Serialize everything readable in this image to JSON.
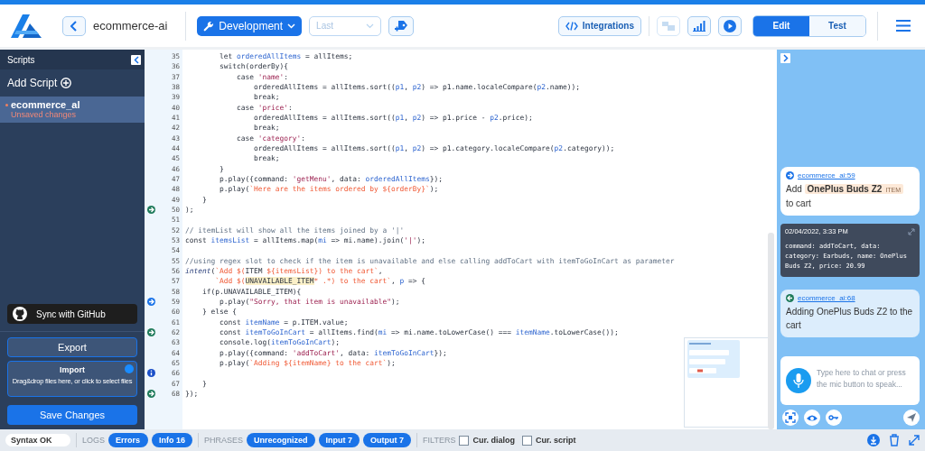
{
  "header": {
    "project": "ecommerce-ai",
    "environment": "Development",
    "version_placeholder": "Last",
    "integrations": "Integrations",
    "modes": [
      {
        "label": "Edit",
        "selected": true
      },
      {
        "label": "Test",
        "selected": false
      }
    ]
  },
  "sidebar": {
    "title": "Scripts",
    "add_script": "Add Script",
    "scripts": [
      {
        "name": "ecommerce_al",
        "status": "Unsaved changes",
        "selected": true
      }
    ],
    "github": "Sync with GitHub",
    "export": "Export",
    "import_title": "Import",
    "import_hint": "Drag&drop files here, or click to select files",
    "save": "Save Changes"
  },
  "editor": {
    "lines": [
      {
        "number": "35",
        "segments": [
          {
            "kind": "plain",
            "text": "        let "
          },
          {
            "kind": "var",
            "text": "orderedAllItems"
          },
          {
            "kind": "plain",
            "text": " = allItems;"
          }
        ]
      },
      {
        "number": "36",
        "segments": [
          {
            "kind": "plain",
            "text": "        switch(orderBy){"
          }
        ]
      },
      {
        "number": "37",
        "segments": [
          {
            "kind": "plain",
            "text": "            case "
          },
          {
            "kind": "string",
            "text": "'name'"
          },
          {
            "kind": "plain",
            "text": ":"
          }
        ]
      },
      {
        "number": "38",
        "segments": [
          {
            "kind": "plain",
            "text": "                orderedAllItems = allItems.sort(("
          },
          {
            "kind": "var",
            "text": "p1"
          },
          {
            "kind": "plain",
            "text": ", "
          },
          {
            "kind": "var",
            "text": "p2"
          },
          {
            "kind": "plain",
            "text": ") => p1.name.localeCompare("
          },
          {
            "kind": "var",
            "text": "p2"
          },
          {
            "kind": "plain",
            "text": ".name));"
          }
        ]
      },
      {
        "number": "39",
        "segments": [
          {
            "kind": "plain",
            "text": "                break;"
          }
        ]
      },
      {
        "number": "40",
        "segments": [
          {
            "kind": "plain",
            "text": "            case "
          },
          {
            "kind": "string",
            "text": "'price'"
          },
          {
            "kind": "plain",
            "text": ":"
          }
        ]
      },
      {
        "number": "41",
        "segments": [
          {
            "kind": "plain",
            "text": "                orderedAllItems = allItems.sort(("
          },
          {
            "kind": "var",
            "text": "p1"
          },
          {
            "kind": "plain",
            "text": ", "
          },
          {
            "kind": "var",
            "text": "p2"
          },
          {
            "kind": "plain",
            "text": ") => p1.price - "
          },
          {
            "kind": "var",
            "text": "p2"
          },
          {
            "kind": "plain",
            "text": ".price);"
          }
        ]
      },
      {
        "number": "42",
        "segments": [
          {
            "kind": "plain",
            "text": "                break;"
          }
        ]
      },
      {
        "number": "43",
        "segments": [
          {
            "kind": "plain",
            "text": "            case "
          },
          {
            "kind": "string",
            "text": "'category'"
          },
          {
            "kind": "plain",
            "text": ":"
          }
        ]
      },
      {
        "number": "44",
        "segments": [
          {
            "kind": "plain",
            "text": "                orderedAllItems = allItems.sort(("
          },
          {
            "kind": "var",
            "text": "p1"
          },
          {
            "kind": "plain",
            "text": ", "
          },
          {
            "kind": "var",
            "text": "p2"
          },
          {
            "kind": "plain",
            "text": ") => p1.category.localeCompare("
          },
          {
            "kind": "var",
            "text": "p2"
          },
          {
            "kind": "plain",
            "text": ".category));"
          }
        ]
      },
      {
        "number": "45",
        "segments": [
          {
            "kind": "plain",
            "text": "                break;"
          }
        ]
      },
      {
        "number": "46",
        "segments": [
          {
            "kind": "plain",
            "text": "        }"
          }
        ]
      },
      {
        "number": "47",
        "segments": [
          {
            "kind": "plain",
            "text": "        p.play({command: "
          },
          {
            "kind": "string",
            "text": "'getMenu'"
          },
          {
            "kind": "plain",
            "text": ", data: "
          },
          {
            "kind": "var",
            "text": "orderedAllItems"
          },
          {
            "kind": "plain",
            "text": "});"
          }
        ]
      },
      {
        "number": "48",
        "segments": [
          {
            "kind": "plain",
            "text": "        p.play("
          },
          {
            "kind": "template",
            "text": "`Here are the items ordered by ${orderBy}`"
          },
          {
            "kind": "plain",
            "text": ");"
          }
        ]
      },
      {
        "number": "49",
        "segments": [
          {
            "kind": "plain",
            "text": "    }"
          }
        ]
      },
      {
        "number": "50",
        "marker": {
          "kind": "out"
        },
        "segments": [
          {
            "kind": "plain",
            "text": ");"
          }
        ]
      },
      {
        "number": "51"
      },
      {
        "number": "52",
        "segments": [
          {
            "kind": "comment",
            "text": "// itemList will show all the items joined by a '|'"
          }
        ]
      },
      {
        "number": "53",
        "segments": [
          {
            "kind": "plain",
            "text": "const "
          },
          {
            "kind": "var",
            "text": "itemsList"
          },
          {
            "kind": "plain",
            "text": " = allItems.map("
          },
          {
            "kind": "var",
            "text": "mi"
          },
          {
            "kind": "plain",
            "text": " => mi.name).join("
          },
          {
            "kind": "string",
            "text": "'|'"
          },
          {
            "kind": "plain",
            "text": ");"
          }
        ]
      },
      {
        "number": "54"
      },
      {
        "number": "55",
        "segments": [
          {
            "kind": "comment",
            "text": "//using regex slot to check if the item is unavailable and else calling addToCart with itemToGoInCart as parameter"
          }
        ]
      },
      {
        "number": "56",
        "segments": [
          {
            "kind": "function",
            "text": "intent"
          },
          {
            "kind": "plain",
            "text": "("
          },
          {
            "kind": "template",
            "text": "`Add $("
          },
          {
            "kind": "plain",
            "text": "ITEM "
          },
          {
            "kind": "template",
            "text": "${itemsList}) to the cart`"
          },
          {
            "kind": "plain",
            "text": ","
          }
        ]
      },
      {
        "number": "57",
        "segments": [
          {
            "kind": "template",
            "text": "       `Add $("
          },
          {
            "kind": "match",
            "text": "UNAVAILABLE_ITEM"
          },
          {
            "kind": "template",
            "text": "* .*) to the cart`"
          },
          {
            "kind": "plain",
            "text": ", "
          },
          {
            "kind": "var",
            "text": "p"
          },
          {
            "kind": "plain",
            "text": " => {"
          }
        ]
      },
      {
        "number": "58",
        "segments": [
          {
            "kind": "plain",
            "text": "    if(p.UNAVAILABLE_ITEM){"
          }
        ]
      },
      {
        "number": "59",
        "marker": {
          "kind": "in"
        },
        "segments": [
          {
            "kind": "plain",
            "text": "        p.play("
          },
          {
            "kind": "string",
            "text": "\"Sorry, that item is unavailable\""
          },
          {
            "kind": "plain",
            "text": ");"
          }
        ]
      },
      {
        "number": "60",
        "segments": [
          {
            "kind": "plain",
            "text": "    } else {"
          }
        ]
      },
      {
        "number": "61",
        "segments": [
          {
            "kind": "plain",
            "text": "        const "
          },
          {
            "kind": "var",
            "text": "itemName"
          },
          {
            "kind": "plain",
            "text": " = p.ITEM.value;"
          }
        ]
      },
      {
        "number": "62",
        "marker": {
          "kind": "out"
        },
        "segments": [
          {
            "kind": "plain",
            "text": "        const "
          },
          {
            "kind": "var",
            "text": "itemToGoInCart"
          },
          {
            "kind": "plain",
            "text": " = allItems.find("
          },
          {
            "kind": "var",
            "text": "mi"
          },
          {
            "kind": "plain",
            "text": " => mi.name.toLowerCase() === "
          },
          {
            "kind": "var",
            "text": "itemName"
          },
          {
            "kind": "plain",
            "text": ".toLowerCase());"
          }
        ]
      },
      {
        "number": "63",
        "segments": [
          {
            "kind": "plain",
            "text": "        console.log("
          },
          {
            "kind": "var",
            "text": "itemToGoInCart"
          },
          {
            "kind": "plain",
            "text": ");"
          }
        ]
      },
      {
        "number": "64",
        "segments": [
          {
            "kind": "plain",
            "text": "        p.play({command: "
          },
          {
            "kind": "string",
            "text": "'addToCart'"
          },
          {
            "kind": "plain",
            "text": ", data: "
          },
          {
            "kind": "var",
            "text": "itemToGoInCart"
          },
          {
            "kind": "plain",
            "text": "});"
          }
        ]
      },
      {
        "number": "65",
        "segments": [
          {
            "kind": "plain",
            "text": "        p.play("
          },
          {
            "kind": "template",
            "text": "`Adding ${itemName} to the cart`"
          },
          {
            "kind": "plain",
            "text": ");"
          }
        ]
      },
      {
        "number": "66",
        "marker": {
          "kind": "info"
        }
      },
      {
        "number": "67",
        "segments": [
          {
            "kind": "plain",
            "text": "    }"
          }
        ]
      },
      {
        "number": "68",
        "marker": {
          "kind": "out"
        },
        "segments": [
          {
            "kind": "plain",
            "text": "});"
          }
        ]
      }
    ]
  },
  "chat": {
    "messages": [
      {
        "kind": "input",
        "source": "ecommerce_ai:59",
        "parts": [
          {
            "text": "Add"
          },
          {
            "text": "OnePlus Buds Z2",
            "tag": "ITEM"
          },
          {
            "text": "to cart"
          }
        ]
      },
      {
        "kind": "log",
        "time": "02/04/2022, 3:33 PM",
        "text": "command: addToCart, data: category: Earbuds, name: OnePlus Buds Z2, price: 20.99"
      },
      {
        "kind": "output",
        "source": "ecommerce_ai:68",
        "parts": [
          {
            "text": "Adding OnePlus Buds Z2 to the cart"
          }
        ]
      }
    ],
    "input_placeholder": "Type here to chat or press the mic button to speak..."
  },
  "status_bar": {
    "syntax": "Syntax OK",
    "groups": [
      {
        "label": "LOGS",
        "buttons": [
          "Errors",
          "Info 16"
        ]
      },
      {
        "label": "PHRASES",
        "buttons": [
          "Unrecognized",
          "Input 7",
          "Output 7"
        ]
      }
    ],
    "filters_label": "FILTERS",
    "filters": [
      {
        "label": "Cur. dialog",
        "checked": false
      },
      {
        "label": "Cur. script",
        "checked": false
      }
    ]
  }
}
